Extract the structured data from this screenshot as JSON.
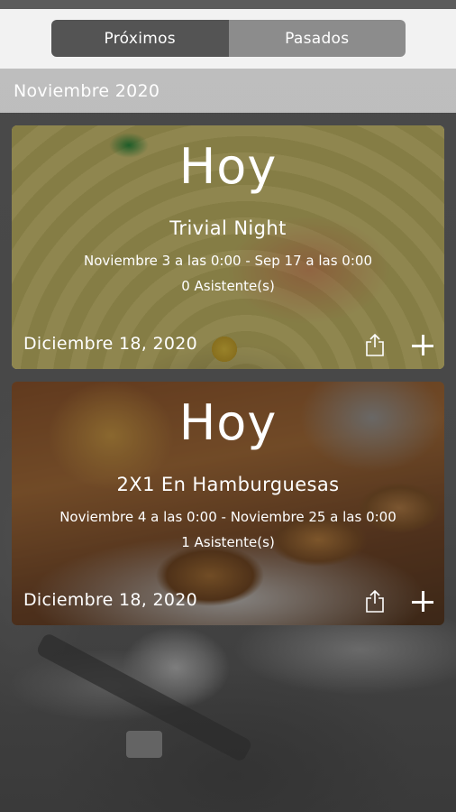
{
  "tabs": [
    {
      "label": "Próximos",
      "active": true
    },
    {
      "label": "Pasados",
      "active": false
    }
  ],
  "month_header": "Noviembre 2020",
  "events": [
    {
      "day_label": "Hoy",
      "title": "Trivial Night",
      "date_range": "Noviembre 3 a las 0:00 - Sep 17 a las 0:00",
      "attendees": "0 Asistente(s)",
      "footer_date": "Diciembre 18, 2020",
      "share_icon": "share-icon",
      "add_icon": "plus-icon"
    },
    {
      "day_label": "Hoy",
      "title": "2X1 En Hamburguesas",
      "date_range": "Noviembre 4 a las 0:00 - Noviembre 25 a las 0:00",
      "attendees": "1 Asistente(s)",
      "footer_date": "Diciembre 18, 2020",
      "share_icon": "share-icon",
      "add_icon": "plus-icon"
    }
  ],
  "colors": {
    "segment_active": "#545454",
    "segment_inactive": "#8c8c8c",
    "month_bar": "#c8c8c8",
    "text": "#ffffff"
  }
}
